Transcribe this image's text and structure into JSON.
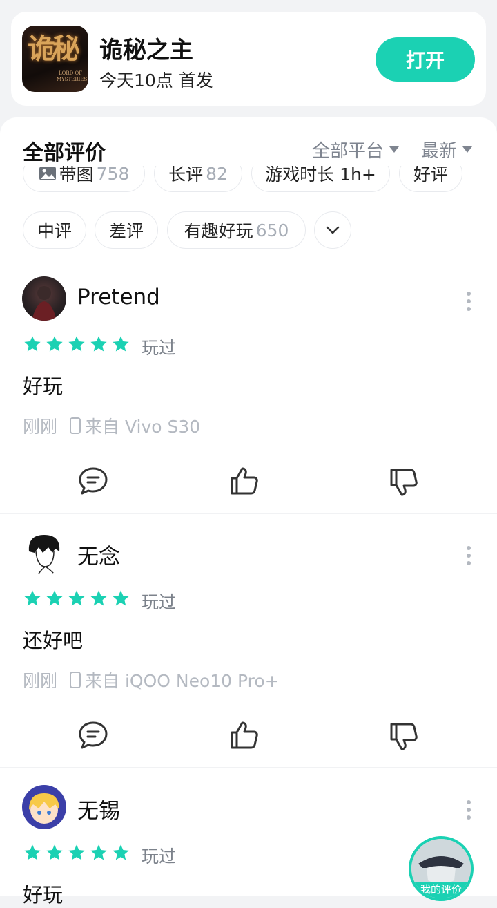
{
  "app": {
    "icon_text": "诡秘",
    "icon_subtext": "LORD OF MYSTERIES",
    "title": "诡秘之主",
    "subtitle": "今天10点 首发",
    "open_label": "打开"
  },
  "reviews_header": {
    "title": "全部评价",
    "platform_filter": "全部平台",
    "sort_filter": "最新"
  },
  "chips_row1": [
    {
      "label": "带图",
      "count": "758",
      "icon": "image-icon"
    },
    {
      "label": "长评",
      "count": "82"
    },
    {
      "label": "游戏时长 1h+",
      "count": ""
    },
    {
      "label": "好评",
      "count": ""
    }
  ],
  "chips_row2": [
    {
      "label": "中评",
      "count": ""
    },
    {
      "label": "差评",
      "count": ""
    },
    {
      "label": "有趣好玩",
      "count": "650"
    }
  ],
  "reviews": [
    {
      "user": "Pretend",
      "rating": 5,
      "status": "玩过",
      "content": "好玩",
      "time": "刚刚",
      "device": "来自 Vivo S30"
    },
    {
      "user": "无念",
      "rating": 5,
      "status": "玩过",
      "content": "还好吧",
      "time": "刚刚",
      "device": "来自 iQOO Neo10 Pro+"
    },
    {
      "user": "无锡",
      "rating": 5,
      "status": "玩过",
      "content": "好玩",
      "time": "",
      "device": ""
    }
  ],
  "my_review_label": "我的评价",
  "colors": {
    "accent": "#1bd1b3",
    "star": "#1bd1b3",
    "muted": "#b4b9c1"
  }
}
